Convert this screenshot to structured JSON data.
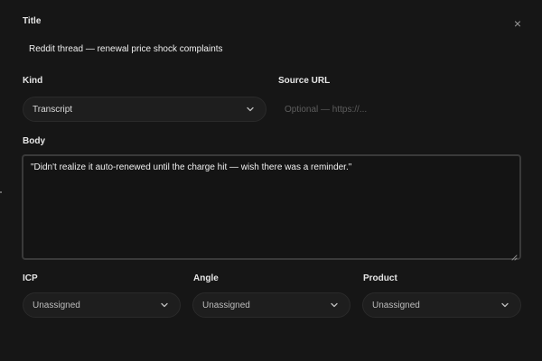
{
  "dialog": {
    "close_icon": "×",
    "title": {
      "label": "Title",
      "value": "Reddit thread — renewal price shock complaints"
    },
    "kind": {
      "label": "Kind",
      "value": "Transcript"
    },
    "source_url": {
      "label": "Source URL",
      "value": "",
      "placeholder": "Optional — https://..."
    },
    "body": {
      "label": "Body",
      "value": "\"Didn't realize it auto-renewed until the charge hit — wish there was a reminder.\""
    },
    "icp": {
      "label": "ICP",
      "value": "Unassigned"
    },
    "angle": {
      "label": "Angle",
      "value": "Unassigned"
    },
    "product": {
      "label": "Product",
      "value": "Unassigned"
    }
  },
  "icons": {
    "close": "close-icon",
    "chevron": "chevron-down-icon"
  },
  "colors": {
    "background": "#161616",
    "field_background": "#1e1e1e",
    "text": "#e8e8e8",
    "placeholder": "#5d5d5d",
    "border": "#3a3a3a"
  }
}
